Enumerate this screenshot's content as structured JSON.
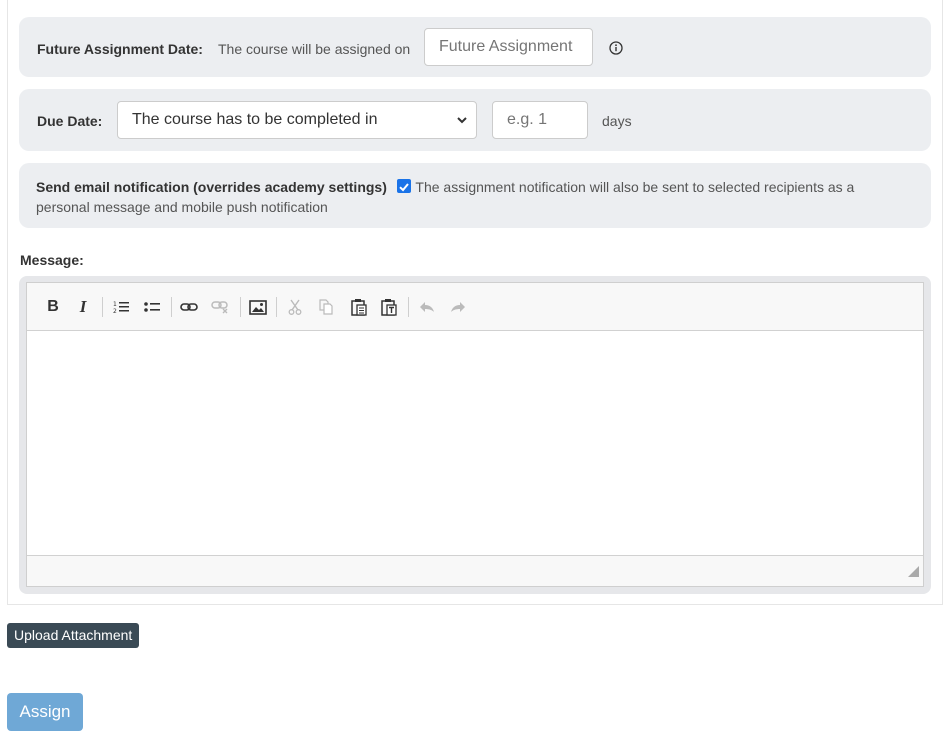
{
  "future_assignment": {
    "label": "Future Assignment Date:",
    "description": "The course will be assigned on",
    "input_placeholder": "Future Assignment"
  },
  "due_date": {
    "label": "Due Date:",
    "select_value": "The course has to be completed in",
    "days_placeholder": "e.g. 1",
    "unit": "days"
  },
  "email_notification": {
    "label": "Send email notification (overrides academy settings)",
    "checked": true,
    "description": "The assignment notification will also be sent to selected recipients as a personal message and mobile push notification"
  },
  "message": {
    "label": "Message:",
    "toolbar": [
      "bold-icon",
      "italic-icon",
      "numbered-list-icon",
      "bulleted-list-icon",
      "link-icon",
      "unlink-icon",
      "image-icon",
      "cut-icon",
      "copy-icon",
      "paste-icon",
      "paste-text-icon",
      "undo-icon",
      "redo-icon"
    ]
  },
  "buttons": {
    "upload": "Upload Attachment",
    "assign": "Assign"
  },
  "colors": {
    "row_bg": "#eceef1",
    "checkbox": "#1a73e8",
    "upload_bg": "#3a4a55",
    "assign_bg": "#6fa8d6"
  }
}
